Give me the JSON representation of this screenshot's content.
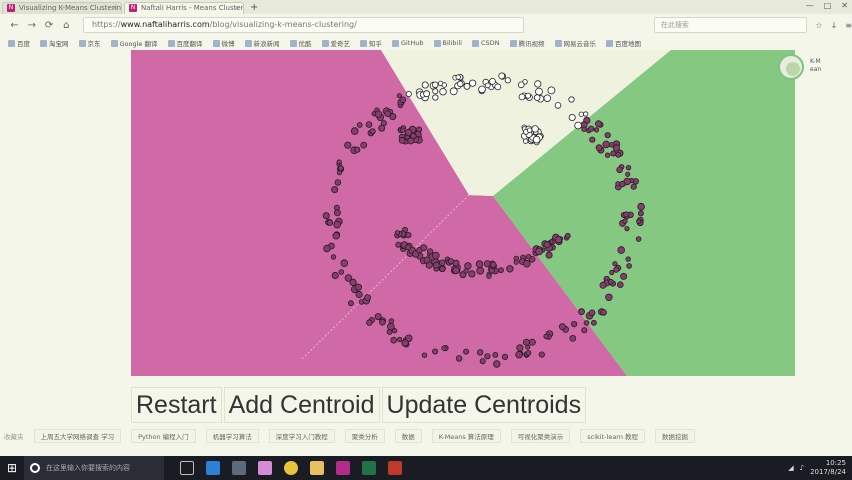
{
  "browser": {
    "tabs": [
      {
        "label": "Visualizing K-Means Clusterin",
        "active": false
      },
      {
        "label": "Naftali Harris - Means Clusterin",
        "active": true
      }
    ],
    "url_prefix": "https://",
    "url_domain": "www.naftaliharris.com",
    "url_path": "/blog/visualizing-k-means-clustering/",
    "search_placeholder": "在此搜索"
  },
  "bookmarks": [
    "百度",
    "淘宝网",
    "京东",
    "Google 翻译",
    "百度翻译",
    "微博",
    "新浪新闻",
    "优酷",
    "爱奇艺",
    "知乎",
    "GitHub",
    "Bilibili",
    "CSDN",
    "腾讯视频",
    "网易云音乐",
    "百度地图"
  ],
  "avatar_tag": [
    "K-M",
    "ean"
  ],
  "buttons": {
    "restart": "Restart",
    "add_centroid": "Add Centroid",
    "update_centroids": "Update Centroids"
  },
  "tasklinks_label": "收藏夹",
  "tasklinks": [
    "上周五大学网络调查 学习",
    "Python 编程入门",
    "机器学习算法",
    "深度学习入门教程",
    "聚类分析",
    "数据",
    "K-Means 算法原理",
    "可视化聚类演示",
    "scikit-learn 教程",
    "数据挖掘"
  ],
  "taskbar": {
    "search_placeholder": "在这里输入你要搜索的内容",
    "time": "10:25",
    "date": "2017/8/24"
  },
  "colors": {
    "pink_region": "#cf6aa6",
    "green_region": "#85c882",
    "white_region": "#eef2df"
  }
}
